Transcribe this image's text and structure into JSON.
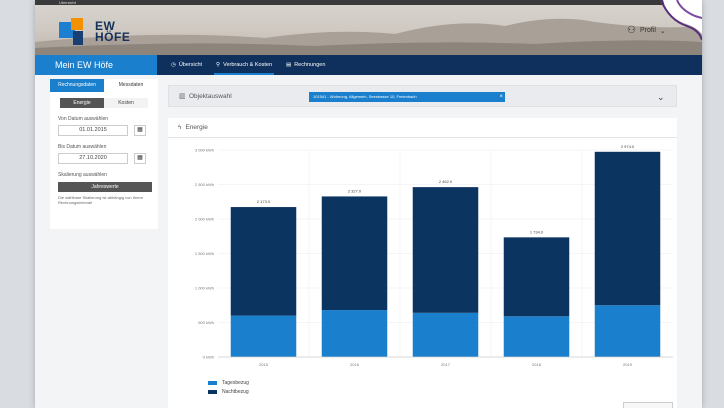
{
  "header": {
    "top_text": "Ubersicht",
    "logo_line1": "EW",
    "logo_line2": "HÖFE",
    "profile_label": "Profil"
  },
  "nav": {
    "brand": "Mein EW Höfe",
    "items": [
      {
        "icon": "chart-icon",
        "glyph": "◷",
        "label": "Übersicht"
      },
      {
        "icon": "bolt-icon",
        "glyph": "⚲",
        "label": "Verbrauch & Kosten"
      },
      {
        "icon": "invoice-icon",
        "glyph": "▤",
        "label": "Rechnungen"
      }
    ]
  },
  "sidebar": {
    "tabs": [
      "Rechnungsdaten",
      "Messdaten"
    ],
    "segments": [
      "Energie",
      "Kosten"
    ],
    "from_label": "Von Datum auswählen",
    "from_value": "01.01.2015",
    "to_label": "Bis Datum auswählen",
    "to_value": "27.10.2020",
    "scale_label": "Skalierung auswählen",
    "scale_button": "Jahreswerte",
    "hint": "Die wählbare Skalierung ist abhängig von Ihrem Rechnungsintervall"
  },
  "object_select": {
    "label": "Objektauswahl",
    "chip": "101541 - Wohnung, Allgemein, Seestrasse 10, Freienbach"
  },
  "chart_card": {
    "title": "Energie"
  },
  "chart_data": {
    "type": "bar",
    "stacked": true,
    "categories": [
      "2015",
      "2016",
      "2017",
      "2018",
      "2019"
    ],
    "series": [
      {
        "name": "Tagesbezug",
        "color": "#1a7fcc",
        "values": [
          600,
          680,
          640,
          590,
          750
        ]
      },
      {
        "name": "Nachtbezug",
        "color": "#0c3460",
        "values": [
          1573,
          1647,
          1822,
          1144,
          2224
        ]
      }
    ],
    "totals": [
      2173,
      2327,
      2462,
      1734,
      2974
    ],
    "total_labels": [
      "2 173.0",
      "2 327.0",
      "2 462.0",
      "1 734.0",
      "2 974.0"
    ],
    "y_ticks": [
      0,
      500,
      1000,
      1500,
      2000,
      2500,
      3000
    ],
    "y_tick_labels": [
      "0 kWh",
      "500 kWh",
      "1 000 kWh",
      "1 500 kWh",
      "2 000 kWh",
      "2 500 kWh",
      "3 000 kWh"
    ],
    "ylim": [
      0,
      3000
    ],
    "legend_position": "bottom-left",
    "grid": true
  }
}
